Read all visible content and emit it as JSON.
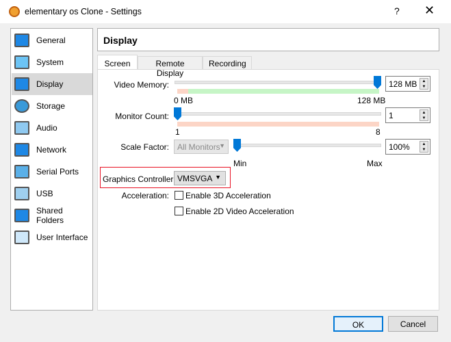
{
  "window": {
    "title": "elementary os Clone - Settings",
    "help": "?",
    "close": "✕"
  },
  "sidebar": {
    "items": [
      {
        "label": "General",
        "icon": "monitor-icon"
      },
      {
        "label": "System",
        "icon": "chip-icon"
      },
      {
        "label": "Display",
        "icon": "display-icon",
        "selected": true
      },
      {
        "label": "Storage",
        "icon": "disk-icon"
      },
      {
        "label": "Audio",
        "icon": "speaker-icon"
      },
      {
        "label": "Network",
        "icon": "network-icon"
      },
      {
        "label": "Serial Ports",
        "icon": "serial-port-icon"
      },
      {
        "label": "USB",
        "icon": "usb-icon"
      },
      {
        "label": "Shared Folders",
        "icon": "folder-icon"
      },
      {
        "label": "User Interface",
        "icon": "window-icon"
      }
    ]
  },
  "header": {
    "title": "Display"
  },
  "tabs": [
    {
      "label": "Screen",
      "active": true
    },
    {
      "label": "Remote Display"
    },
    {
      "label": "Recording"
    }
  ],
  "screen": {
    "video_memory": {
      "label": "Video Memory:",
      "value": "128 MB",
      "min_label": "0 MB",
      "max_label": "128 MB",
      "level": 1.0
    },
    "monitor_count": {
      "label": "Monitor Count:",
      "value": "1",
      "min_label": "1",
      "max_label": "8",
      "level": 0
    },
    "scale_factor": {
      "label": "Scale Factor:",
      "monitor_select": "All Monitors",
      "value": "100%",
      "min_label": "Min",
      "max_label": "Max",
      "level": 0
    },
    "graphics_controller": {
      "label": "Graphics Controller:",
      "value": "VMSVGA"
    },
    "acceleration": {
      "label": "Acceleration:",
      "enable_3d": "Enable 3D Acceleration",
      "enable_2d": "Enable 2D Video Acceleration",
      "enable_3d_checked": false,
      "enable_2d_checked": false
    }
  },
  "buttons": {
    "ok": "OK",
    "cancel": "Cancel"
  },
  "colors": {
    "accent": "#0078d7",
    "highlight_box": "#e81123",
    "bar_green": "#c6f5c6",
    "bar_red": "#fcd5c6"
  }
}
